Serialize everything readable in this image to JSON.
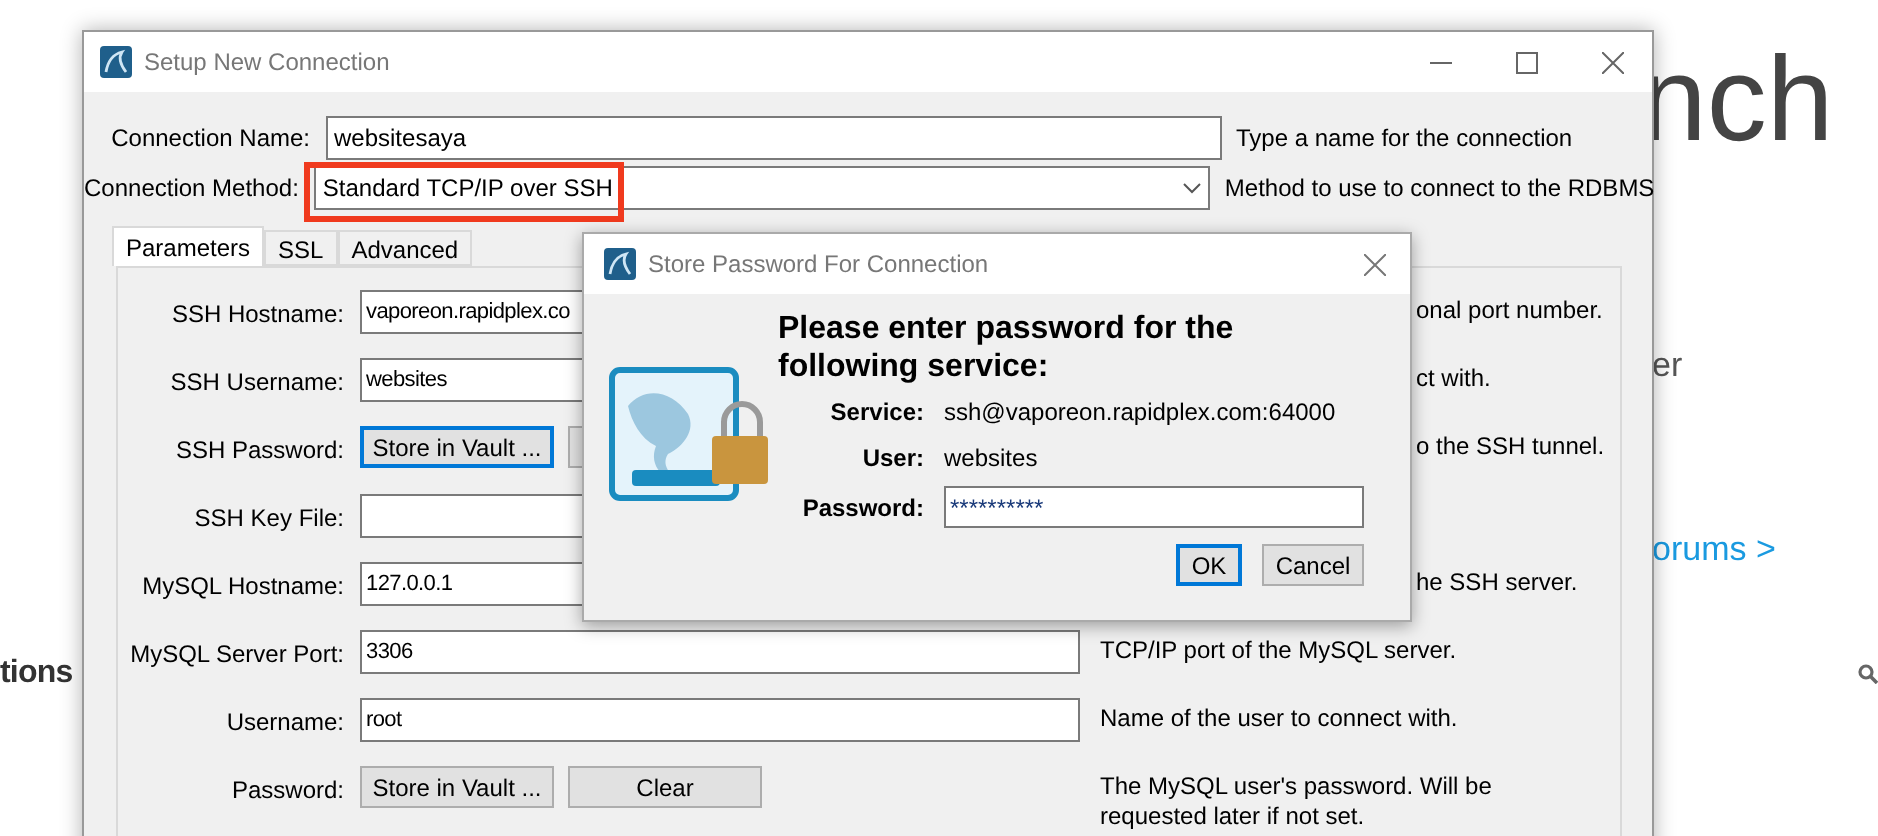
{
  "background": {
    "heading": "nch",
    "line_1": "er",
    "link": "orums >",
    "section": "tions"
  },
  "window": {
    "title": "Setup New Connection",
    "top_fields": [
      {
        "label": "Connection Name:",
        "kind": "text",
        "value": "websitesaya",
        "hint": "Type a name for the connection",
        "highlighted": false
      },
      {
        "label": "Connection Method:",
        "kind": "select",
        "value": "Standard TCP/IP over SSH",
        "hint": "Method to use to connect to the RDBMS",
        "highlighted": true
      }
    ],
    "tabs": [
      {
        "label": "Parameters",
        "selected": true
      },
      {
        "label": "SSL",
        "selected": false
      },
      {
        "label": "Advanced",
        "selected": false
      }
    ],
    "rows": [
      {
        "label": "SSH Hostname:",
        "kind": "text",
        "value": "vaporeon.rapidplex.co",
        "hint": "onal port number.",
        "hint_clipped": true
      },
      {
        "label": "SSH Username:",
        "kind": "text",
        "value": "websites",
        "hint": "ct with.",
        "hint_clipped": true
      },
      {
        "label": "SSH Password:",
        "kind": "buttons",
        "buttons": [
          {
            "label": "Store in Vault ...",
            "focused": true
          }
        ],
        "hint": "o the SSH tunnel.",
        "hint_clipped": true
      },
      {
        "label": "SSH Key File:",
        "kind": "text"
      },
      {
        "label": "MySQL Hostname:",
        "kind": "text",
        "value": "127.0.0.1",
        "hint": "he SSH server.",
        "hint_clipped": true
      },
      {
        "label": "MySQL Server Port:",
        "kind": "text",
        "value": "3306",
        "hint": "TCP/IP port of the MySQL server.",
        "hint_clipped": false
      },
      {
        "label": "Username:",
        "kind": "text",
        "value": "root",
        "hint": "Name of the user to connect with.",
        "hint_clipped": false
      },
      {
        "label": "Password:",
        "kind": "buttons",
        "buttons": [
          {
            "label": "Store in Vault ...",
            "focused": false
          },
          {
            "label": "Clear",
            "focused": false
          }
        ],
        "hint": "The MySQL user's password. Will be requested later if not set.",
        "hint_clipped": false
      }
    ]
  },
  "dialog": {
    "title": "Store Password For Connection",
    "heading": "Please enter password for the following service:",
    "rows": [
      {
        "label": "Service:",
        "kind": "value",
        "value": "ssh@vaporeon.rapidplex.com:64000"
      },
      {
        "label": "User:",
        "kind": "value",
        "value": "websites"
      },
      {
        "label": "Password:",
        "kind": "input",
        "value": "**********"
      }
    ],
    "buttons": [
      {
        "label": "OK",
        "focused": true
      },
      {
        "label": "Cancel",
        "focused": false
      }
    ]
  }
}
